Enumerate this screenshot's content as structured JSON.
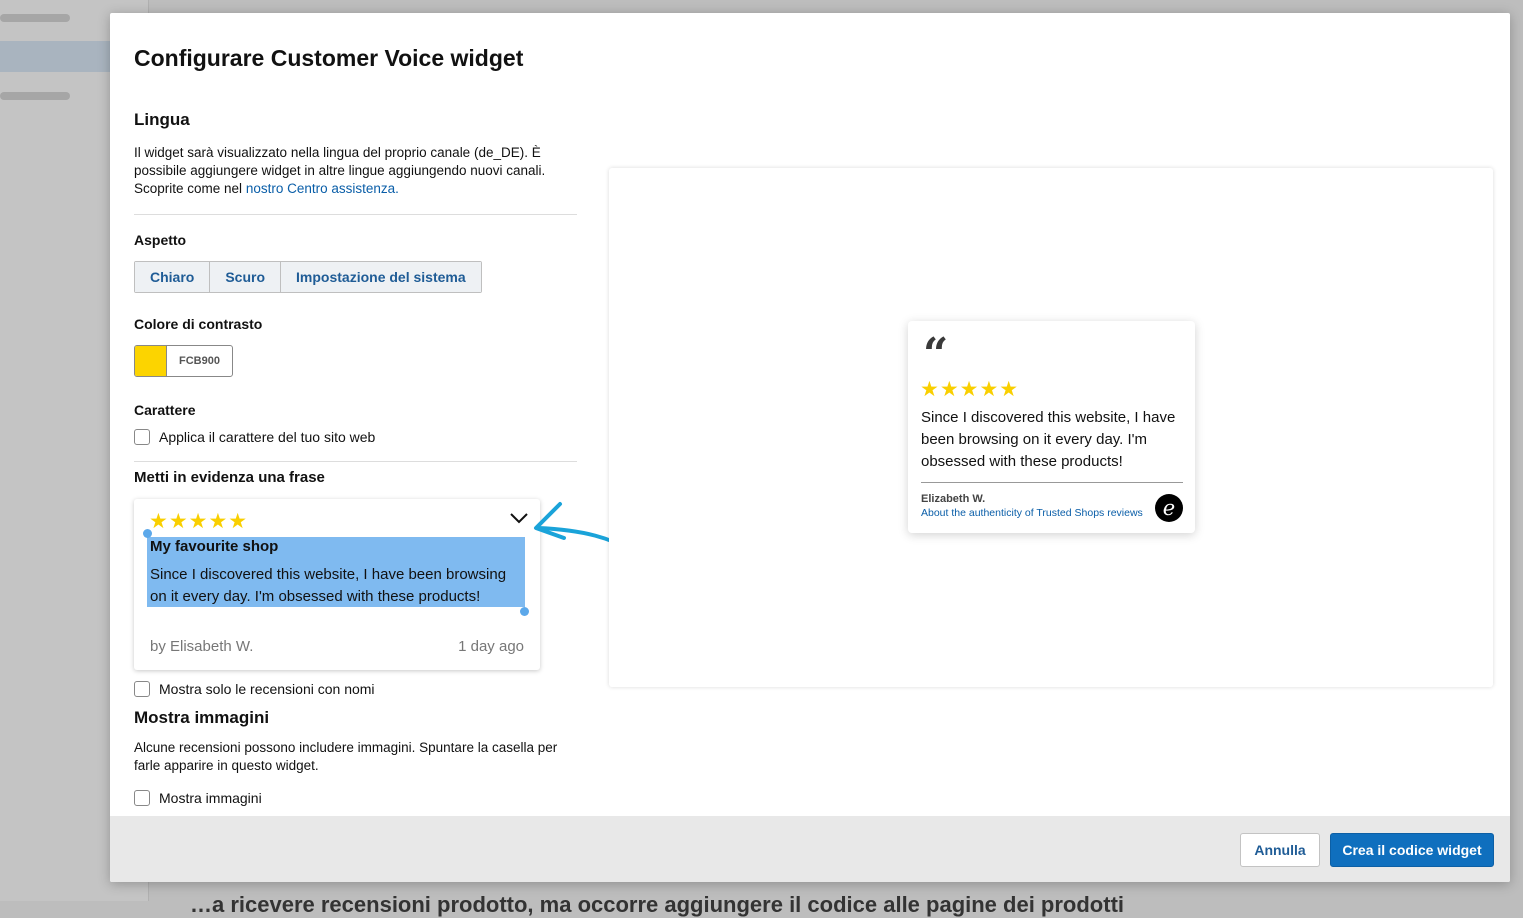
{
  "background": {
    "main_text": "…a ricevere recensioni prodotto, ma occorre aggiungere il codice alle pagine dei prodotti"
  },
  "modal": {
    "title": "Configurare Customer Voice widget"
  },
  "language": {
    "heading": "Lingua",
    "text": "Il widget sarà visualizzato nella lingua del proprio canale (de_DE). È possibile aggiungere widget in altre lingue aggiungendo nuovi canali. Scoprite come nel",
    "link": "nostro Centro assistenza."
  },
  "appearance": {
    "label": "Aspetto",
    "options": [
      "Chiaro",
      "Scuro",
      "Impostazione del sistema"
    ]
  },
  "contrast": {
    "label": "Colore di contrasto",
    "hex": "FCB900",
    "color": "#FCD400"
  },
  "font": {
    "label": "Carattere",
    "checkbox": "Applica il carattere del tuo sito web"
  },
  "highlight": {
    "heading": "Metti in evidenza una frase",
    "stars": "★★★★★",
    "title": "My favourite shop",
    "text_line1": "Since I discovered this website, I have been browsing",
    "text_line2": "on it every day. I'm obsessed with these products!",
    "author": "by Elisabeth W.",
    "date": "1 day ago"
  },
  "names_only": {
    "checkbox": "Mostra solo le recensioni con nomi"
  },
  "images": {
    "heading": "Mostra immagini",
    "text": "Alcune recensioni possono includere immagini. Spuntare la casella per farle apparire in questo widget.",
    "checkbox": "Mostra immagini"
  },
  "preview": {
    "quote_mark": "66",
    "stars": "★★★★★",
    "text": "Since I discovered this website, I have been browsing on it every day. I'm obsessed with these products!",
    "author": "Elizabeth W.",
    "authenticity_link": "About the authenticity of Trusted Shops reviews",
    "logo_letter": "e"
  },
  "footer": {
    "cancel": "Annulla",
    "create": "Crea il codice widget"
  },
  "colors": {
    "primary": "#0F6FBE",
    "link": "#0A5EA8",
    "star": "#F9CF00",
    "arrow": "#1AA3D9",
    "selection": "#7FBAF0"
  }
}
